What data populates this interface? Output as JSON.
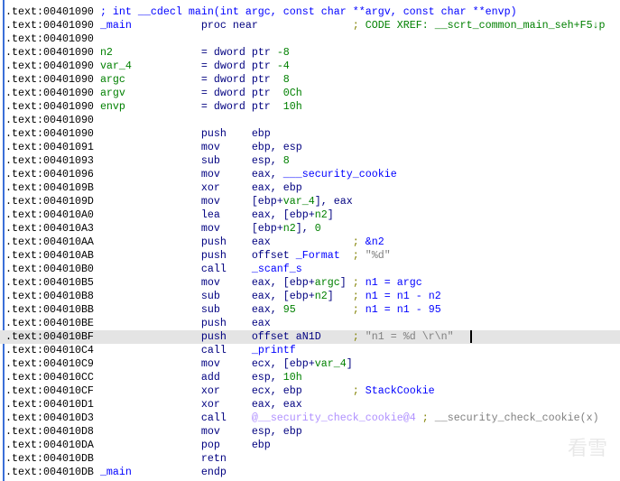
{
  "highlighted_line": 24,
  "watermark": "看雪",
  "colors": {
    "address": "#000000",
    "label": "#0000ff",
    "mnemonic": "#000080",
    "number": "#008000",
    "comment": "#0000ff",
    "string_comment": "#808080",
    "highlight": "#e4e4e4"
  },
  "lines": [
    [
      [
        "a",
        ".text:00401090 "
      ],
      [
        "c",
        "; int __cdecl main(int argc, const char **argv, const char **envp)"
      ]
    ],
    [
      [
        "a",
        ".text:00401090 "
      ],
      [
        "l",
        "_main"
      ],
      [
        "m",
        "           proc near               "
      ],
      [
        "sc",
        "; "
      ],
      [
        "x",
        "CODE XREF: __scrt_common_main_seh+F5↓p"
      ]
    ],
    [
      [
        "a",
        ".text:00401090"
      ]
    ],
    [
      [
        "a",
        ".text:00401090 "
      ],
      [
        "g",
        "n2"
      ],
      [
        "m",
        "              = dword ptr "
      ],
      [
        "g",
        "-8"
      ]
    ],
    [
      [
        "a",
        ".text:00401090 "
      ],
      [
        "g",
        "var_4"
      ],
      [
        "m",
        "           = dword ptr "
      ],
      [
        "g",
        "-4"
      ]
    ],
    [
      [
        "a",
        ".text:00401090 "
      ],
      [
        "g",
        "argc"
      ],
      [
        "m",
        "            = dword ptr  "
      ],
      [
        "g",
        "8"
      ]
    ],
    [
      [
        "a",
        ".text:00401090 "
      ],
      [
        "g",
        "argv"
      ],
      [
        "m",
        "            = dword ptr  "
      ],
      [
        "g",
        "0Ch"
      ]
    ],
    [
      [
        "a",
        ".text:00401090 "
      ],
      [
        "g",
        "envp"
      ],
      [
        "m",
        "            = dword ptr  "
      ],
      [
        "g",
        "10h"
      ]
    ],
    [
      [
        "a",
        ".text:00401090"
      ]
    ],
    [
      [
        "a",
        ".text:00401090 "
      ],
      [
        "m",
        "                push    ebp"
      ]
    ],
    [
      [
        "a",
        ".text:00401091 "
      ],
      [
        "m",
        "                mov     ebp, esp"
      ]
    ],
    [
      [
        "a",
        ".text:00401093 "
      ],
      [
        "m",
        "                sub     esp, "
      ],
      [
        "g",
        "8"
      ]
    ],
    [
      [
        "a",
        ".text:00401096 "
      ],
      [
        "m",
        "                mov     eax, "
      ],
      [
        "l",
        "___security_cookie"
      ]
    ],
    [
      [
        "a",
        ".text:0040109B "
      ],
      [
        "m",
        "                xor     eax, ebp"
      ]
    ],
    [
      [
        "a",
        ".text:0040109D "
      ],
      [
        "m",
        "                mov     [ebp+"
      ],
      [
        "g",
        "var_4"
      ],
      [
        "m",
        "], eax"
      ]
    ],
    [
      [
        "a",
        ".text:004010A0 "
      ],
      [
        "m",
        "                lea     eax, [ebp+"
      ],
      [
        "g",
        "n2"
      ],
      [
        "m",
        "]"
      ]
    ],
    [
      [
        "a",
        ".text:004010A3 "
      ],
      [
        "m",
        "                mov     [ebp+"
      ],
      [
        "g",
        "n2"
      ],
      [
        "m",
        "], "
      ],
      [
        "g",
        "0"
      ]
    ],
    [
      [
        "a",
        ".text:004010AA "
      ],
      [
        "m",
        "                push    eax             "
      ],
      [
        "sc",
        "; "
      ],
      [
        "c",
        "&n2"
      ]
    ],
    [
      [
        "a",
        ".text:004010AB "
      ],
      [
        "m",
        "                push    offset "
      ],
      [
        "l",
        "_Format"
      ],
      [
        "m",
        "  "
      ],
      [
        "sc",
        "; "
      ],
      [
        "s",
        "\"%d\""
      ]
    ],
    [
      [
        "a",
        ".text:004010B0 "
      ],
      [
        "m",
        "                call    "
      ],
      [
        "l",
        "_scanf_s"
      ]
    ],
    [
      [
        "a",
        ".text:004010B5 "
      ],
      [
        "m",
        "                mov     eax, [ebp+"
      ],
      [
        "g",
        "argc"
      ],
      [
        "m",
        "] "
      ],
      [
        "sc",
        "; "
      ],
      [
        "c",
        "n1 = argc"
      ]
    ],
    [
      [
        "a",
        ".text:004010B8 "
      ],
      [
        "m",
        "                sub     eax, [ebp+"
      ],
      [
        "g",
        "n2"
      ],
      [
        "m",
        "]   "
      ],
      [
        "sc",
        "; "
      ],
      [
        "c",
        "n1 = n1 - n2"
      ]
    ],
    [
      [
        "a",
        ".text:004010BB "
      ],
      [
        "m",
        "                sub     eax, "
      ],
      [
        "g",
        "95"
      ],
      [
        "m",
        "         "
      ],
      [
        "sc",
        "; "
      ],
      [
        "c",
        "n1 = n1 - 95"
      ]
    ],
    [
      [
        "a",
        ".text:004010BE "
      ],
      [
        "m",
        "                push    eax"
      ]
    ],
    [
      [
        "a",
        ".text:004010BF "
      ],
      [
        "m",
        "                push    offset aN1D     "
      ],
      [
        "sc",
        "; "
      ],
      [
        "s",
        "\"n1 = %d \\r\\n\""
      ]
    ],
    [
      [
        "a",
        ".text:004010C4 "
      ],
      [
        "m",
        "                call    "
      ],
      [
        "l",
        "_printf"
      ]
    ],
    [
      [
        "a",
        ".text:004010C9 "
      ],
      [
        "m",
        "                mov     ecx, [ebp+"
      ],
      [
        "g",
        "var_4"
      ],
      [
        "m",
        "]"
      ]
    ],
    [
      [
        "a",
        ".text:004010CC "
      ],
      [
        "m",
        "                add     esp, "
      ],
      [
        "g",
        "10h"
      ]
    ],
    [
      [
        "a",
        ".text:004010CF "
      ],
      [
        "m",
        "                xor     ecx, ebp        "
      ],
      [
        "sc",
        "; "
      ],
      [
        "c",
        "StackCookie"
      ]
    ],
    [
      [
        "a",
        ".text:004010D1 "
      ],
      [
        "m",
        "                xor     eax, eax"
      ]
    ],
    [
      [
        "a",
        ".text:004010D3 "
      ],
      [
        "m",
        "                call    "
      ],
      [
        "p",
        "@__security_check_cookie@4"
      ],
      [
        "m",
        " "
      ],
      [
        "sc",
        "; "
      ],
      [
        "s",
        "__security_check_cookie(x)"
      ]
    ],
    [
      [
        "a",
        ".text:004010D8 "
      ],
      [
        "m",
        "                mov     esp, ebp"
      ]
    ],
    [
      [
        "a",
        ".text:004010DA "
      ],
      [
        "m",
        "                pop     ebp"
      ]
    ],
    [
      [
        "a",
        ".text:004010DB "
      ],
      [
        "m",
        "                retn"
      ]
    ],
    [
      [
        "a",
        ".text:004010DB "
      ],
      [
        "l",
        "_main"
      ],
      [
        "m",
        "           endp"
      ]
    ]
  ]
}
